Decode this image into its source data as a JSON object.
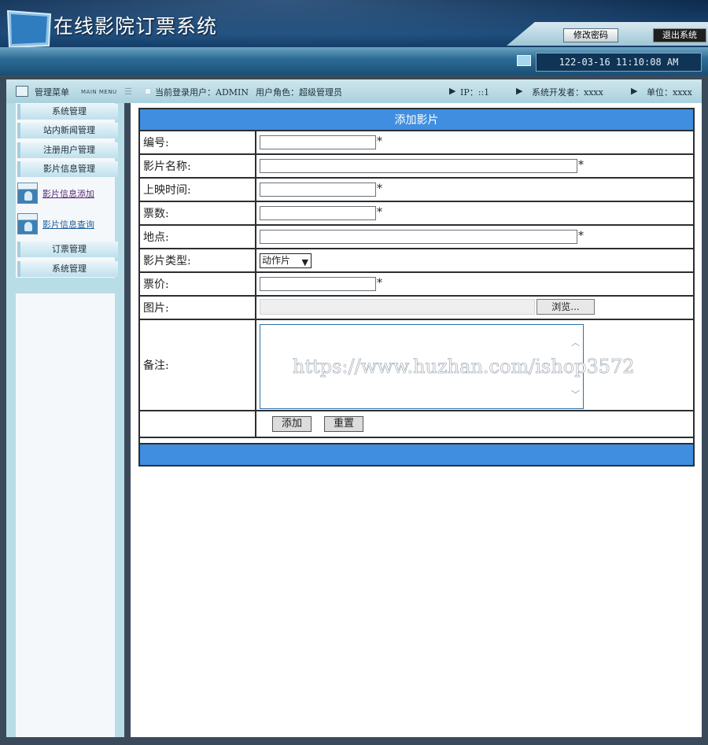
{
  "header": {
    "title": "在线影院订票系统",
    "change_password": "修改密码",
    "logout": "退出系统",
    "datetime": "122-03-16 11:10:08 AM"
  },
  "infobar": {
    "menu_label": "管理菜单",
    "menu_label_en": "MAIN MENU",
    "current_user": "当前登录用户：ADMIN",
    "user_role": "用户角色：超级管理员",
    "ip": "IP：::1",
    "developer": "系统开发者：xxxx",
    "unit": "单位：xxxx"
  },
  "sidebar": {
    "items": [
      {
        "label": "系统管理"
      },
      {
        "label": "站内新闻管理"
      },
      {
        "label": "注册用户管理"
      },
      {
        "label": "影片信息管理"
      }
    ],
    "subitems": [
      {
        "label": "影片信息添加"
      },
      {
        "label": "影片信息查询"
      }
    ],
    "items_after": [
      {
        "label": "订票管理"
      },
      {
        "label": "系统管理"
      }
    ]
  },
  "form": {
    "title": "添加影片",
    "fields": {
      "id_label": "编号:",
      "name_label": "影片名称:",
      "time_label": "上映时间:",
      "tickets_label": "票数:",
      "location_label": "地点:",
      "type_label": "影片类型:",
      "type_value": "动作片",
      "price_label": "票价:",
      "image_label": "图片:",
      "browse": "浏览...",
      "remark_label": "备注:",
      "required_mark": "*"
    },
    "buttons": {
      "add": "添加",
      "reset": "重置"
    },
    "watermark": "https://www.huzhan.com/ishop3572"
  }
}
